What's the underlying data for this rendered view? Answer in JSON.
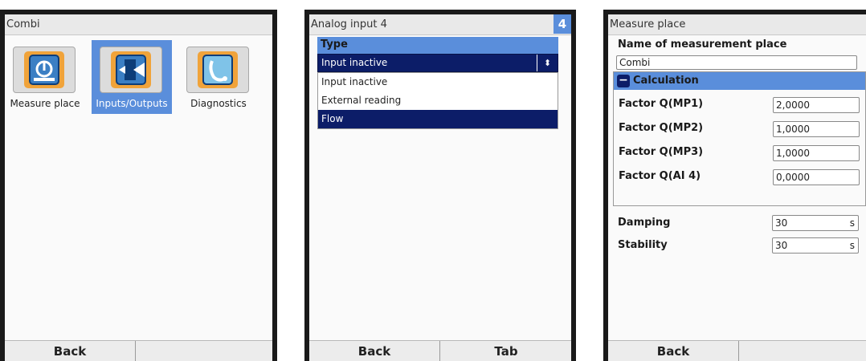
{
  "screen1": {
    "title": "Combi",
    "tiles": [
      {
        "label": "Measure place",
        "icon": "measure-place-icon"
      },
      {
        "label": "Inputs/Outputs",
        "icon": "inputs-outputs-icon"
      },
      {
        "label": "Diagnostics",
        "icon": "diagnostics-icon"
      }
    ],
    "softkeys": {
      "left": "Back",
      "right": ""
    }
  },
  "screen2": {
    "title": "Analog input 4",
    "badge": "4",
    "section_label": "Type",
    "select_value": "Input inactive",
    "options": [
      "Input inactive",
      "External reading",
      "Flow"
    ],
    "softkeys": {
      "left": "Back",
      "right": "Tab"
    }
  },
  "screen3": {
    "title": "Measure place",
    "name_label": "Name of measurement place",
    "name_value": "Combi",
    "calc_header": "Calculation",
    "factors": [
      {
        "label": "Factor Q(MP1)",
        "value": "2,0000"
      },
      {
        "label": "Factor Q(MP2)",
        "value": "1,0000"
      },
      {
        "label": "Factor Q(MP3)",
        "value": "1,0000"
      },
      {
        "label": "Factor Q(AI 4)",
        "value": "0,0000"
      }
    ],
    "damping_label": "Damping",
    "damping_value": "30",
    "damping_unit": "s",
    "stability_label": "Stability",
    "stability_value": "30",
    "stability_unit": "s",
    "softkeys": {
      "left": "Back",
      "right": ""
    }
  },
  "colors": {
    "selection_blue": "#5a8edb",
    "dropdown_navy": "#0c1d68",
    "orange_icon": "#f0a33a"
  }
}
